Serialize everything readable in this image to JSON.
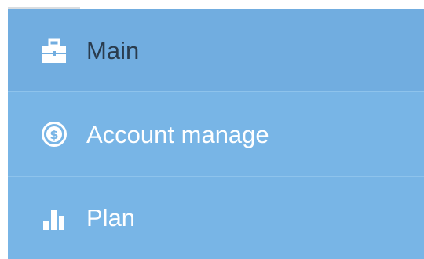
{
  "menu": {
    "items": [
      {
        "label": "Main",
        "icon": "briefcase-icon"
      },
      {
        "label": "Account manage",
        "icon": "dollar-circle-icon"
      },
      {
        "label": "Plan",
        "icon": "bar-chart-icon"
      }
    ]
  },
  "colors": {
    "menu_background": "#78b5e6",
    "active_item_background": "#71ade0",
    "active_text": "#2a3c4e",
    "text": "#ffffff",
    "divider": "#8ec3ec"
  }
}
